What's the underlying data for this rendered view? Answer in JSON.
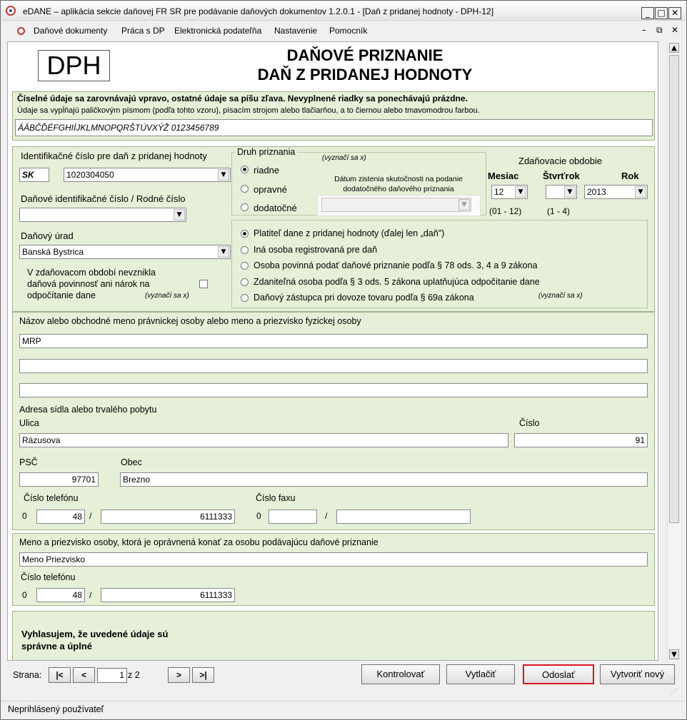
{
  "window": {
    "title": "eDANE – aplikácia sekcie daňovej FR SR pre podávanie daňových dokumentov  1.2.0.1 - [Daň z pridanej hodnoty - DPH-12]",
    "min": "_",
    "max": "□",
    "close": "✕"
  },
  "menu": {
    "items": [
      "Daňové dokumenty",
      "Práca s DP",
      "Elektronická podateľňa",
      "Nastavenie",
      "Pomocník"
    ],
    "mdi_min": "–",
    "mdi_restore": "⧉",
    "mdi_close": "✕"
  },
  "form": {
    "logo": "DPH",
    "title1": "DAŇOVÉ PRIZNANIE",
    "title2": "DAŇ Z PRIDANEJ HODNOTY",
    "instr_bold": "Číselné údaje sa zarovnávajú vpravo, ostatné údaje sa píšu zľava. Nevyplnené riadky sa ponechávajú prázdne.",
    "instr": "Údaje sa vypĺňajú paličkovým písmom (podľa tohto vzoru), písacím strojom alebo tlačiarňou, a to čiernou alebo tmavomodrou farbou.",
    "sample": "ÁÄBČĎÉFGHIÍJKLMNOPQRŠTÚVXÝŽ 0123456789",
    "ic_dph_label": "Identifikačné číslo pre daň z pridanej hodnoty",
    "ic_prefix": "SK",
    "ic_dph": "1020304050",
    "dic_label": "Daňové identifikačné číslo / Rodné číslo",
    "dic": "",
    "urad_label": "Daňový úrad",
    "urad": "Banská Bystrica",
    "nevzn_label1": "V zdaňovacom období nevznikla",
    "nevzn_label2": "daňová povinnosť ani nárok na",
    "nevzn_label3": "odpočítanie dane",
    "vyznac": "(vyznačí sa x)",
    "druh_label": "Druh priznania",
    "druh_vyznac": "(vyznačí sa x)",
    "druh": [
      "riadne",
      "opravné",
      "dodatočné"
    ],
    "datum_label1": "Dátum zistenia skutočnosti na podanie",
    "datum_label2": "dodatočného daňového priznania",
    "obdobie_label": "Zdaňovacie obdobie",
    "mesiac_label": "Mesiac",
    "stvrtrok_label": "Štvrťrok",
    "rok_label": "Rok",
    "mesiac": "12",
    "stvrtrok": "",
    "rok": "2013",
    "mesiac_range": "(01 - 12)",
    "stvrtrok_range": "(1 - 4)",
    "osoba": [
      "Platiteľ dane z pridanej hodnoty (ďalej len „daň\")",
      "Iná osoba registrovaná pre daň",
      "Osoba povinná podať daňové priznanie podľa § 78 ods. 3, 4 a 9 zákona",
      "Zdaniteľná osoba podľa § 3 ods. 5 zákona uplatňujúca odpočítanie dane",
      "Daňový zástupca pri dovoze tovaru podľa § 69a zákona"
    ],
    "osoba_vyznac": "(vyznačí sa x)",
    "nazov_label": "Názov alebo obchodné meno právnickej osoby alebo meno a priezvisko fyzickej osoby",
    "nazov1": "MRP",
    "nazov2": "",
    "nazov3": "",
    "adresa_label": "Adresa sídla alebo trvalého pobytu",
    "ulica_label": "Ulica",
    "ulica": "Rázusova",
    "cislo_label": "Číslo",
    "cislo": "91",
    "psc_label": "PSČ",
    "psc": "97701",
    "obec_label": "Obec",
    "obec": "Brezno",
    "tel_label": "Číslo telefónu",
    "tel_prefix": "0",
    "tel_area": "48",
    "tel_num": "6111333",
    "slash": "/",
    "fax_label": "Číslo faxu",
    "fax_prefix": "0",
    "fax_area": "",
    "fax_num": "",
    "opr_label": "Meno a priezvisko osoby, ktorá je oprávnená konať za osobu podávajúcu daňové priznanie",
    "opr_meno": "Meno Priezvisko",
    "opr_tel_label": "Číslo telefónu",
    "opr_tel_prefix": "0",
    "opr_tel_area": "48",
    "opr_tel_num": "6111333",
    "vyhl1": "Vyhlasujem, že uvedené údaje sú",
    "vyhl2": "správne a úplné"
  },
  "nav": {
    "strana_label": "Strana:",
    "first": "|<",
    "prev": "<",
    "page": "1",
    "of": "z 2",
    "next": ">",
    "last": ">|"
  },
  "actions": {
    "kontrolovat": "Kontrolovať",
    "vytlacit": "Vytlačiť",
    "odoslat": "Odoslať",
    "vytvorit": "Vytvoriť nový",
    "highlight": "#d9141b"
  },
  "status": {
    "user": "Neprihlásený používateľ"
  }
}
